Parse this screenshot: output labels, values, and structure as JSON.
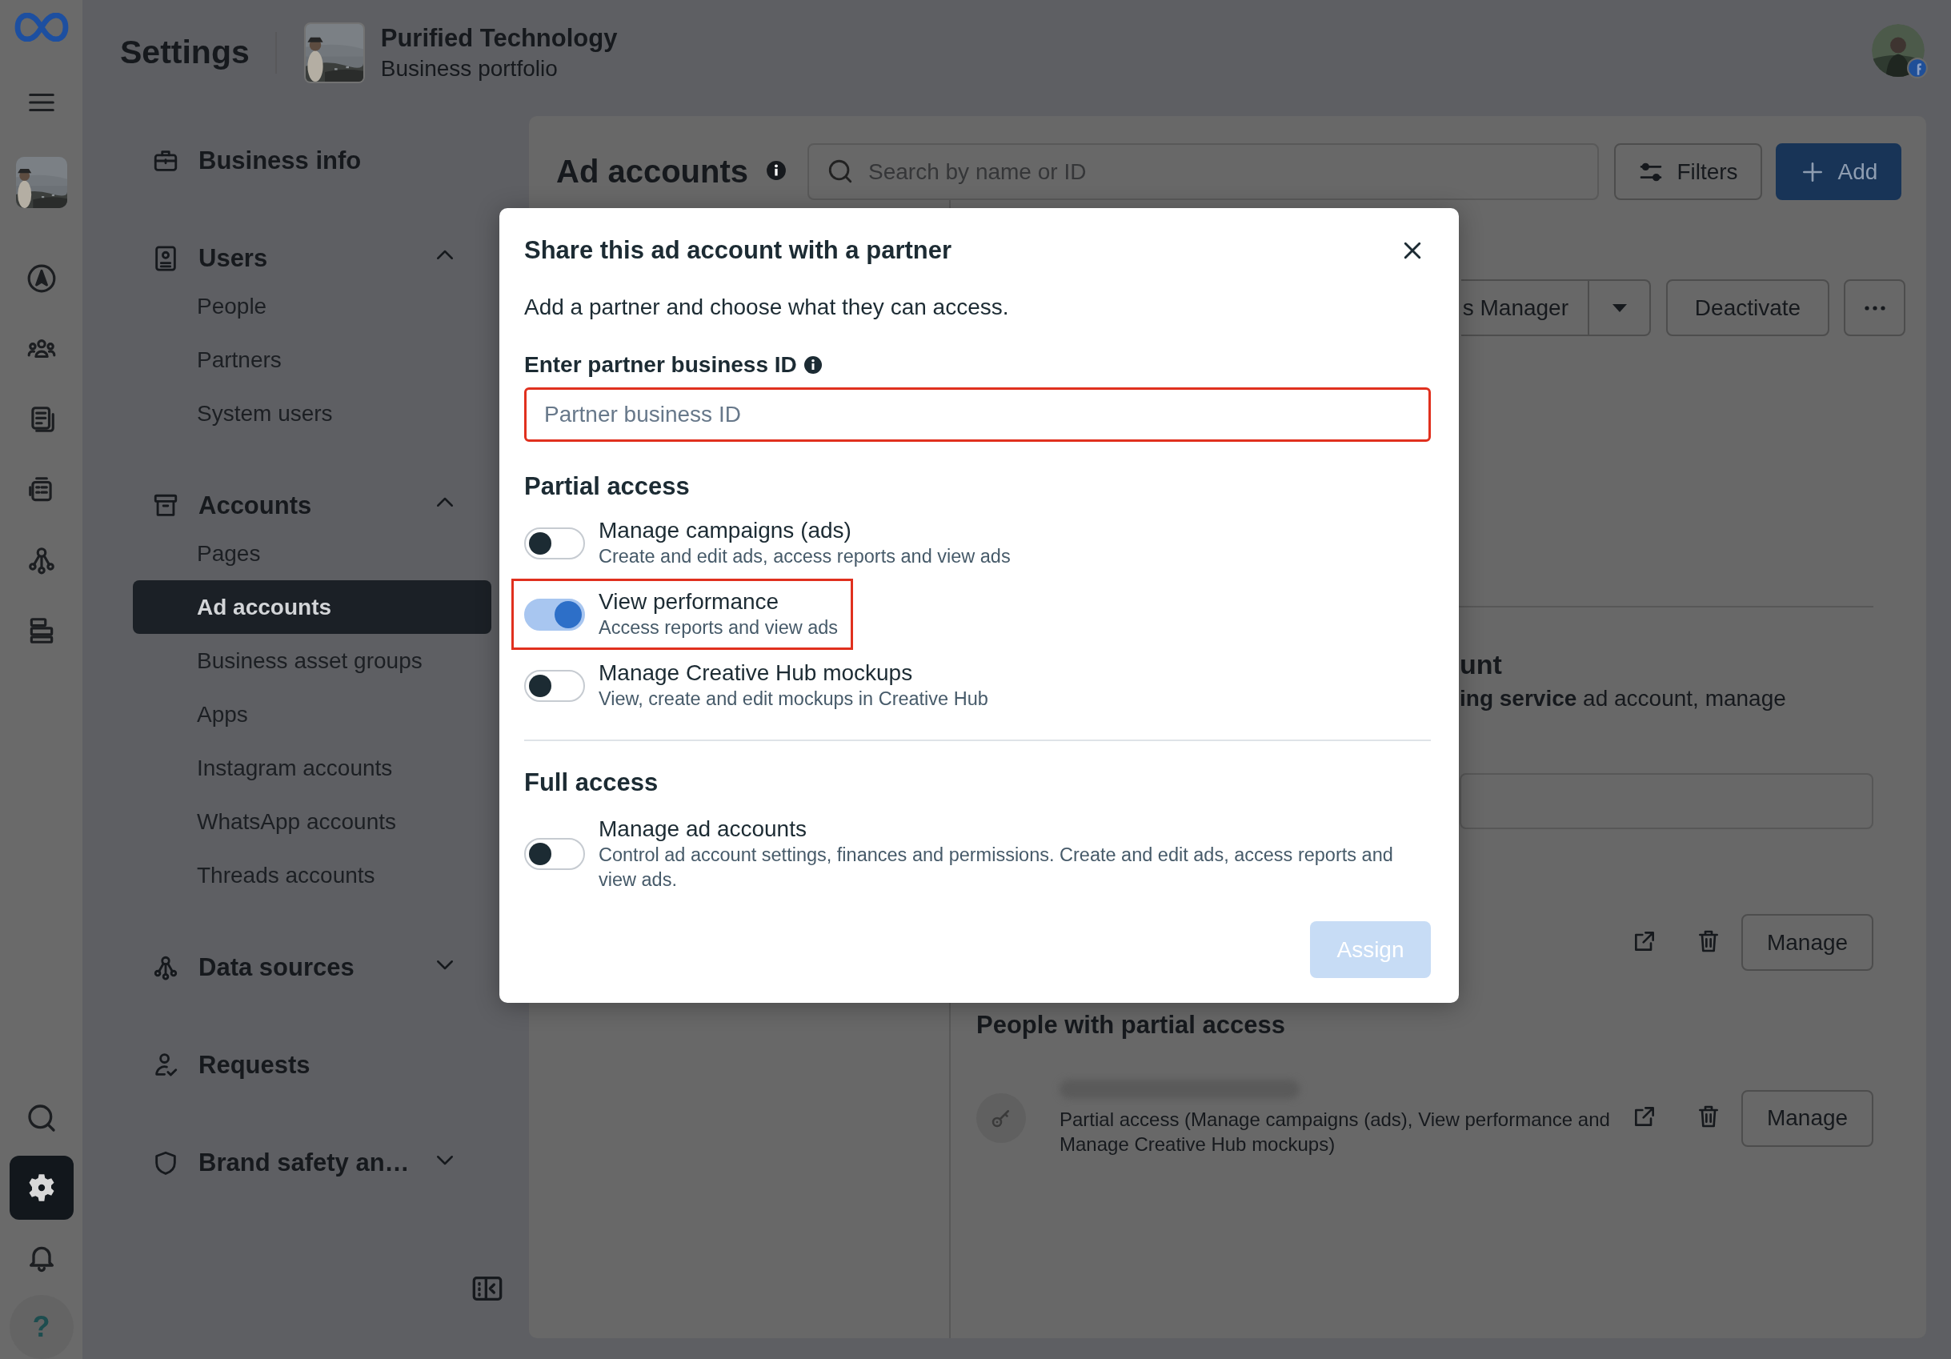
{
  "rail": {
    "nav": [
      {
        "selected": false
      },
      {
        "selected": false
      },
      {
        "selected": false
      },
      {
        "selected": false
      },
      {
        "selected": false
      },
      {
        "selected": false
      }
    ],
    "bottom": [
      {
        "selected": false
      },
      {
        "selected": true
      },
      {
        "selected": false
      }
    ],
    "help": "?"
  },
  "header": {
    "title": "Settings",
    "portfolio": {
      "name": "Purified Technology",
      "subtitle": "Business portfolio"
    }
  },
  "sidebar": {
    "sections": [
      {
        "kind": "link",
        "label": "Business info"
      },
      {
        "kind": "group",
        "label": "Users",
        "expanded": true,
        "children": [
          {
            "label": "People",
            "selected": false
          },
          {
            "label": "Partners",
            "selected": false
          },
          {
            "label": "System users",
            "selected": false
          }
        ]
      },
      {
        "kind": "group",
        "label": "Accounts",
        "expanded": true,
        "children": [
          {
            "label": "Pages",
            "selected": false
          },
          {
            "label": "Ad accounts",
            "selected": true
          },
          {
            "label": "Business asset groups",
            "selected": false
          },
          {
            "label": "Apps",
            "selected": false
          },
          {
            "label": "Instagram accounts",
            "selected": false
          },
          {
            "label": "WhatsApp accounts",
            "selected": false
          },
          {
            "label": "Threads accounts",
            "selected": false
          }
        ]
      },
      {
        "kind": "group",
        "label": "Data sources",
        "expanded": false
      },
      {
        "kind": "link",
        "label": "Requests"
      },
      {
        "kind": "group",
        "label": "Brand safety an…",
        "expanded": false
      }
    ]
  },
  "ad_accounts": {
    "title": "Ad accounts",
    "search": {
      "placeholder": "Search by name or ID"
    },
    "filters": "Filters",
    "add": "Add",
    "actions": {
      "split_button": "s Manager",
      "deactivate": "Deactivate"
    },
    "details": {
      "heading": "unt",
      "description": "**ing service** ad account, manage",
      "full_access_row": {
        "manage": "Manage"
      },
      "partial_access": {
        "heading": "People with partial access",
        "people": [
          {
            "description": "Partial access (Manage campaigns (ads), View performance and Manage Creative Hub mockups)",
            "manage": "Manage"
          }
        ]
      }
    }
  },
  "modal": {
    "title": "Share this ad account with a partner",
    "subtitle": "Add a partner and choose what they can access.",
    "id_field": {
      "label": "Enter partner business ID",
      "placeholder": "Partner business ID",
      "highlighted": true
    },
    "sections": [
      {
        "heading": "Partial access",
        "options": [
          {
            "title": "Manage campaigns (ads)",
            "description": "Create and edit ads, access reports and view ads",
            "on": false,
            "highlighted": false
          },
          {
            "title": "View performance",
            "description": "Access reports and view ads",
            "on": true,
            "highlighted": true
          },
          {
            "title": "Manage Creative Hub mockups",
            "description": "View, create and edit mockups in Creative Hub",
            "on": false,
            "highlighted": false
          }
        ]
      },
      {
        "heading": "Full access",
        "options": [
          {
            "title": "Manage ad accounts",
            "description": "Control ad account settings, finances and permissions. Create and edit ads, access reports and view ads.",
            "on": false,
            "highlighted": false
          }
        ]
      }
    ],
    "assign": {
      "label": "Assign",
      "disabled": true
    }
  }
}
